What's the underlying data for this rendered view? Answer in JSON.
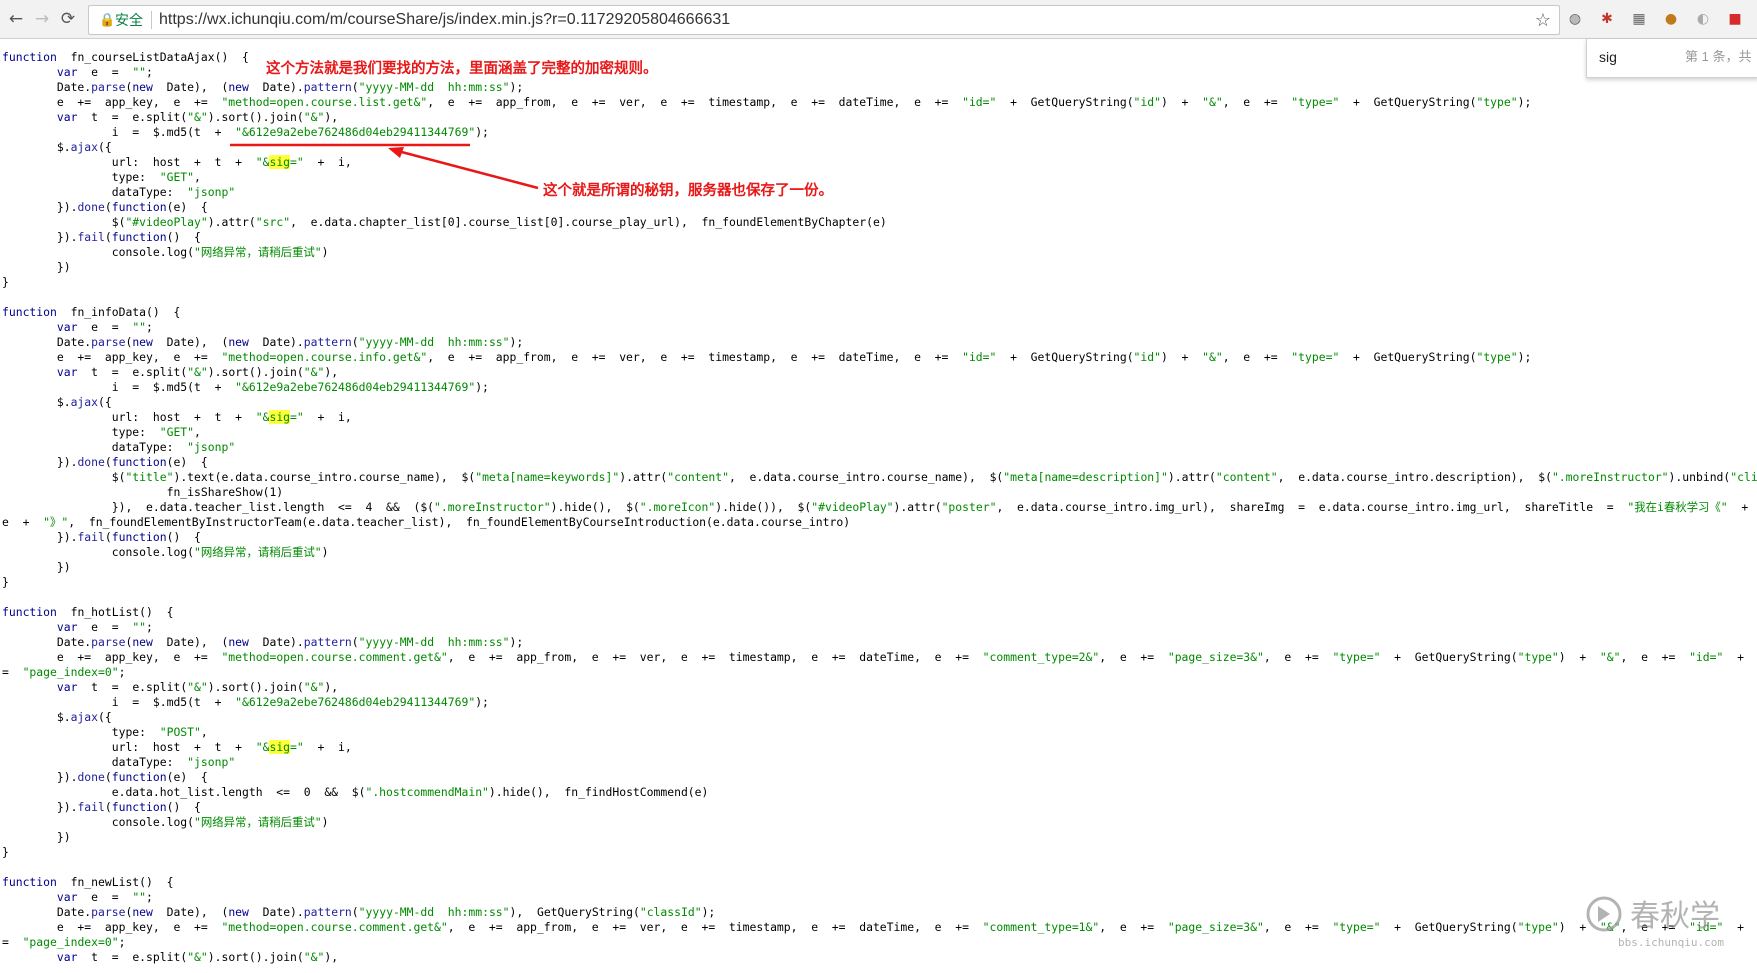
{
  "browser": {
    "secure_label": "安全",
    "url": "https://wx.ichunqiu.com/m/courseShare/js/index.min.js?r=0.11729205804666631"
  },
  "find_bar": {
    "query": "sig",
    "result": "第 1 条，共"
  },
  "annotations": {
    "method_note": "这个方法就是我们要找的方法，里面涵盖了完整的加密规则。",
    "key_note": "这个就是所谓的秘钥，服务器也保存了一份。"
  },
  "code_lines": [
    "function  fn_courseListDataAjax()  {",
    "        var  e  =  \"\";",
    "        Date.parse(new  Date),  (new  Date).pattern(\"yyyy-MM-dd  hh:mm:ss\");",
    "        e  +=  app_key,  e  +=  \"method=open.course.list.get&\",  e  +=  app_from,  e  +=  ver,  e  +=  timestamp,  e  +=  dateTime,  e  +=  \"id=\"  +  GetQueryString(\"id\")  +  \"&\",  e  +=  \"type=\"  +  GetQueryString(\"type\");",
    "        var  t  =  e.split(\"&\").sort().join(\"&\"),",
    "                i  =  $.md5(t  +  \"&612e9a2ebe762486d04eb29411344769\");",
    "        $.ajax({",
    "                url:  host  +  t  +  \"&sig=\"  +  i,",
    "                type:  \"GET\",",
    "                dataType:  \"jsonp\"",
    "        }).done(function(e)  {",
    "                $(\"#videoPlay\").attr(\"src\",  e.data.chapter_list[0].course_list[0].course_play_url),  fn_foundElementByChapter(e)",
    "        }).fail(function()  {",
    "                console.log(\"网络异常，请稍后重试\")",
    "        })",
    "}",
    "",
    "function  fn_infoData()  {",
    "        var  e  =  \"\";",
    "        Date.parse(new  Date),  (new  Date).pattern(\"yyyy-MM-dd  hh:mm:ss\");",
    "        e  +=  app_key,  e  +=  \"method=open.course.info.get&\",  e  +=  app_from,  e  +=  ver,  e  +=  timestamp,  e  +=  dateTime,  e  +=  \"id=\"  +  GetQueryString(\"id\")  +  \"&\",  e  +=  \"type=\"  +  GetQueryString(\"type\");",
    "        var  t  =  e.split(\"&\").sort().join(\"&\"),",
    "                i  =  $.md5(t  +  \"&612e9a2ebe762486d04eb29411344769\");",
    "        $.ajax({",
    "                url:  host  +  t  +  \"&sig=\"  +  i,",
    "                type:  \"GET\",",
    "                dataType:  \"jsonp\"",
    "        }).done(function(e)  {",
    "                $(\"title\").text(e.data.course_intro.course_name),  $(\"meta[name=keywords]\").attr(\"content\",  e.data.course_intro.course_name),  $(\"meta[name=description]\").attr(\"content\",  e.data.course_intro.description),  $(\".moreInstructor\").unbind(\"click\").bind(\"cli",
    "                        fn_isShareShow(1)",
    "                }),  e.data.teacher_list.length  <=  4  &&  ($(\".moreInstructor\").hide(),  $(\".moreIcon\").hide()),  $(\"#videoPlay\").attr(\"poster\",  e.data.course_intro.img_url),  shareImg  =  e.data.course_intro.img_url,  shareTitle  =  \"我在i春秋学习《\"  +  e.data.cour",
    "e  +  \"》\",  fn_foundElementByInstructorTeam(e.data.teacher_list),  fn_foundElementByCourseIntroduction(e.data.course_intro)",
    "        }).fail(function()  {",
    "                console.log(\"网络异常，请稍后重试\")",
    "        })",
    "}",
    "",
    "function  fn_hotList()  {",
    "        var  e  =  \"\";",
    "        Date.parse(new  Date),  (new  Date).pattern(\"yyyy-MM-dd  hh:mm:ss\");",
    "        e  +=  app_key,  e  +=  \"method=open.course.comment.get&\",  e  +=  app_from,  e  +=  ver,  e  +=  timestamp,  e  +=  dateTime,  e  +=  \"comment_type=2&\",  e  +=  \"page_size=3&\",  e  +=  \"type=\"  +  GetQueryString(\"type\")  +  \"&\",  e  +=  \"id=\"  +  GetQueryString",
    "=  \"page_index=0\";",
    "        var  t  =  e.split(\"&\").sort().join(\"&\"),",
    "                i  =  $.md5(t  +  \"&612e9a2ebe762486d04eb29411344769\");",
    "        $.ajax({",
    "                type:  \"POST\",",
    "                url:  host  +  t  +  \"&sig=\"  +  i,",
    "                dataType:  \"jsonp\"",
    "        }).done(function(e)  {",
    "                e.data.hot_list.length  <=  0  &&  $(\".hostcommendMain\").hide(),  fn_findHostCommend(e)",
    "        }).fail(function()  {",
    "                console.log(\"网络异常，请稍后重试\")",
    "        })",
    "}",
    "",
    "function  fn_newList()  {",
    "        var  e  =  \"\";",
    "        Date.parse(new  Date),  (new  Date).pattern(\"yyyy-MM-dd  hh:mm:ss\"),  GetQueryString(\"classId\");",
    "        e  +=  app_key,  e  +=  \"method=open.course.comment.get&\",  e  +=  app_from,  e  +=  ver,  e  +=  timestamp,  e  +=  dateTime,  e  +=  \"comment_type=1&\",  e  +=  \"page_size=3&\",  e  +=  \"type=\"  +  GetQueryString(\"type\")  +  \"&\",  e  +=  \"id=\"  +  GetQueryString",
    "=  \"page_index=0\";",
    "        var  t  =  e.split(\"&\").sort().join(\"&\"),"
  ]
}
